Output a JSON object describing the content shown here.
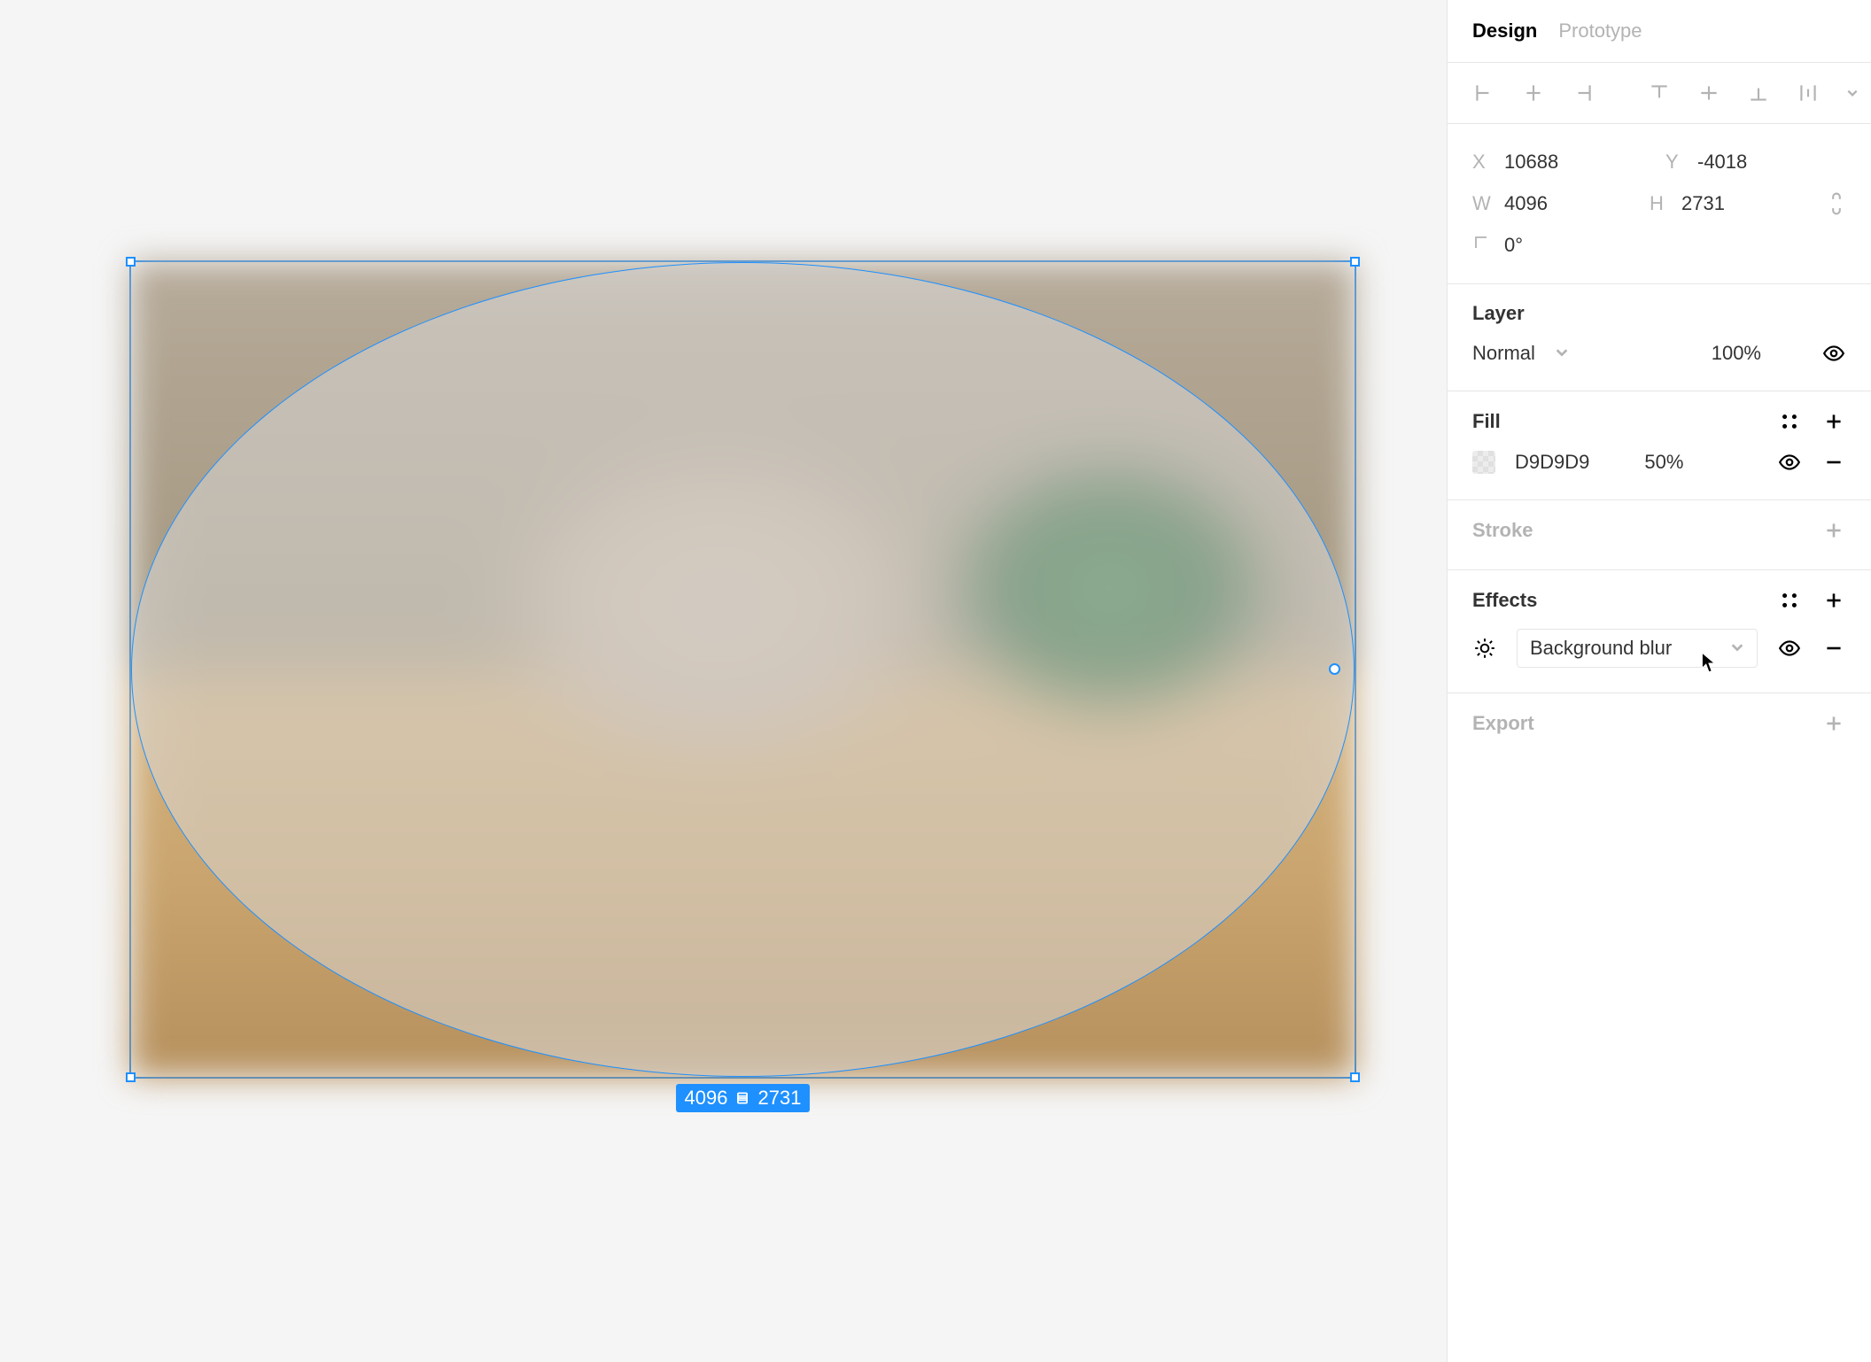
{
  "tabs": {
    "design": "Design",
    "prototype": "Prototype",
    "active": "design"
  },
  "transform": {
    "x_label": "X",
    "x": "10688",
    "y_label": "Y",
    "y": "-4018",
    "w_label": "W",
    "w": "4096",
    "h_label": "H",
    "h": "2731",
    "rotation": "0°"
  },
  "dim_badge": {
    "w": "4096",
    "h": "2731"
  },
  "layer": {
    "title": "Layer",
    "blend": "Normal",
    "opacity": "100%"
  },
  "fill": {
    "title": "Fill",
    "hex": "D9D9D9",
    "opacity": "50%"
  },
  "stroke": {
    "title": "Stroke"
  },
  "effects": {
    "title": "Effects",
    "type": "Background blur"
  },
  "export": {
    "title": "Export"
  }
}
